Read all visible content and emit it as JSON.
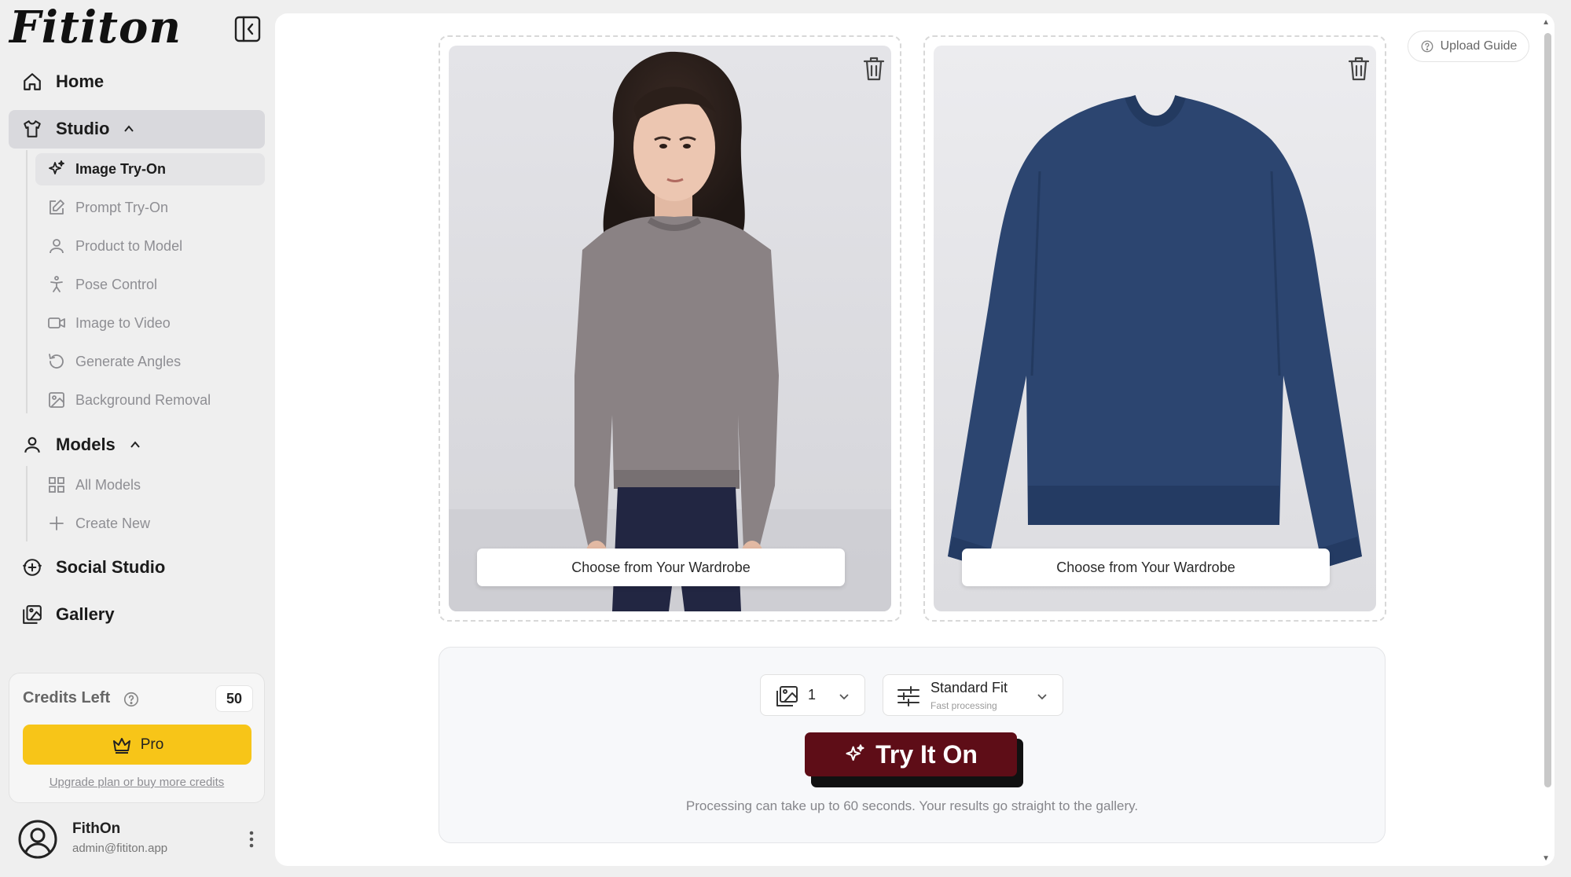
{
  "brand": {
    "logo": "Fititon"
  },
  "sidebar": {
    "home": "Home",
    "studio": {
      "label": "Studio",
      "items": [
        {
          "label": "Image Try-On",
          "icon": "sparkles-icon",
          "active": true
        },
        {
          "label": "Prompt Try-On",
          "icon": "edit-icon"
        },
        {
          "label": "Product to Model",
          "icon": "user-icon"
        },
        {
          "label": "Pose Control",
          "icon": "pose-icon"
        },
        {
          "label": "Image to Video",
          "icon": "video-icon"
        },
        {
          "label": "Generate Angles",
          "icon": "rotate-icon"
        },
        {
          "label": "Background Removal",
          "icon": "image-icon"
        }
      ]
    },
    "models": {
      "label": "Models",
      "items": [
        {
          "label": "All Models",
          "icon": "grid-icon"
        },
        {
          "label": "Create New",
          "icon": "plus-icon"
        }
      ]
    },
    "social_studio": "Social Studio",
    "gallery": "Gallery",
    "credits": {
      "title": "Credits Left",
      "count": "50",
      "pro_label": "Pro",
      "upgrade_link": "Upgrade plan or buy more credits"
    },
    "user": {
      "name": "FithOn",
      "email": "admin@fititon.app"
    }
  },
  "main": {
    "upload_guide": "Upload Guide",
    "model_panel": {
      "wardrobe_button": "Choose from Your Wardrobe"
    },
    "garment_panel": {
      "wardrobe_button": "Choose from Your Wardrobe"
    },
    "controls": {
      "count_value": "1",
      "fit_title": "Standard Fit",
      "fit_subtitle": "Fast processing",
      "try_button": "Try It On",
      "processing_note": "Processing can take up to 60 seconds. Your results go straight to the gallery."
    }
  },
  "colors": {
    "accent_pro": "#f7c518",
    "try_button": "#5e0d17",
    "sweater_grey": "#8a8284",
    "sweater_navy": "#2c4570"
  }
}
